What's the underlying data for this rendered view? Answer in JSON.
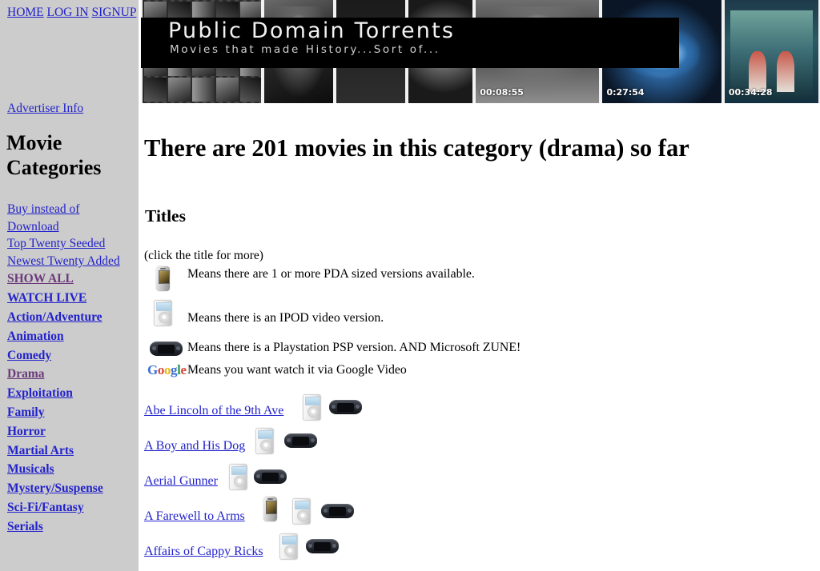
{
  "sidebar": {
    "top_nav": [
      {
        "label": "HOME"
      },
      {
        "label": "LOG IN"
      },
      {
        "label": "SIGNUP"
      }
    ],
    "advertiser_label": "Advertiser Info",
    "categories_heading": "Movie Categories",
    "links": [
      {
        "label": "Buy instead of Download",
        "style": "plain",
        "visited": false
      },
      {
        "label": "Top Twenty Seeded",
        "style": "plain",
        "visited": false
      },
      {
        "label": "Newest Twenty Added",
        "style": "plain",
        "visited": false
      },
      {
        "label": "SHOW ALL",
        "style": "bold",
        "visited": true
      },
      {
        "label": "WATCH LIVE",
        "style": "bold",
        "visited": false
      },
      {
        "label": "Action/Adventure",
        "style": "bold",
        "visited": false
      },
      {
        "label": "Animation",
        "style": "bold",
        "visited": false
      },
      {
        "label": "Comedy",
        "style": "bold",
        "visited": false
      },
      {
        "label": "Drama",
        "style": "bold",
        "visited": true
      },
      {
        "label": "Exploitation",
        "style": "bold",
        "visited": false
      },
      {
        "label": "Family",
        "style": "bold",
        "visited": false
      },
      {
        "label": "Horror",
        "style": "bold",
        "visited": false
      },
      {
        "label": "Martial Arts",
        "style": "bold",
        "visited": false
      },
      {
        "label": "Musicals",
        "style": "bold",
        "visited": false
      },
      {
        "label": "Mystery/Suspense",
        "style": "bold",
        "visited": false
      },
      {
        "label": "Sci-Fi/Fantasy",
        "style": "bold",
        "visited": false
      },
      {
        "label": "Serials",
        "style": "bold",
        "visited": false
      }
    ],
    "colors": {
      "background": "#cccccc",
      "link": "#2222cc",
      "visited_link": "#6a3a7a"
    }
  },
  "banner": {
    "title": "Public Domain Torrents",
    "subtitle": "Movies that made History...Sort of...",
    "timestamps": [
      "00:08:55",
      "0:27:54",
      "00:34:28"
    ],
    "background": "#000000",
    "title_color": "#f2f2f2"
  },
  "main": {
    "headline": "There are 201 movies in this category (drama) so far",
    "movie_count": 201,
    "category": "drama",
    "titles_heading": "Titles",
    "click_note": "(click the title for more)",
    "legend": [
      {
        "icon": "pda-icon",
        "text": "Means there are 1 or more PDA sized versions available."
      },
      {
        "icon": "ipod-icon",
        "text": "Means there is an IPOD video version."
      },
      {
        "icon": "psp-icon",
        "text": "Means there is a Playstation PSP version. AND Microsoft ZUNE!"
      },
      {
        "icon": "google-video-icon",
        "text": "Means you want watch it via Google Video"
      }
    ],
    "google_logo_letters": [
      "G",
      "o",
      "o",
      "g",
      "l",
      "e"
    ],
    "movies": [
      {
        "title": "Abe Lincoln of the 9th Ave",
        "icons": [
          "ipod-icon",
          "psp-icon"
        ]
      },
      {
        "title": "A Boy and His Dog",
        "icons": [
          "ipod-icon",
          "psp-icon"
        ]
      },
      {
        "title": "Aerial Gunner",
        "icons": [
          "ipod-icon",
          "psp-icon"
        ]
      },
      {
        "title": "A Farewell to Arms",
        "icons": [
          "pda-icon",
          "ipod-icon",
          "psp-icon"
        ]
      },
      {
        "title": "Affairs of Cappy Ricks",
        "icons": [
          "ipod-icon",
          "psp-icon"
        ]
      }
    ]
  }
}
